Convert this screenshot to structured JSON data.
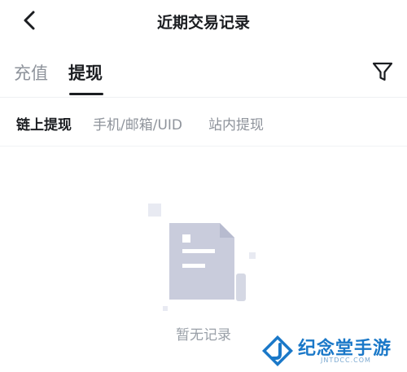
{
  "header": {
    "title": "近期交易记录",
    "back_icon": "chevron-left-icon"
  },
  "tabs": [
    {
      "label": "充值",
      "active": false
    },
    {
      "label": "提现",
      "active": true
    }
  ],
  "filter_icon": "filter-icon",
  "subtabs": [
    {
      "label": "链上提现",
      "active": true
    },
    {
      "label": "手机/邮箱/UID",
      "active": false
    },
    {
      "label": "站内提现",
      "active": false
    }
  ],
  "empty_state": {
    "text": "暂无记录",
    "icon": "empty-document-icon"
  },
  "watermark": {
    "title": "纪念堂手游",
    "subtitle": "JNTDCC.COM",
    "icon": "j-logo-icon"
  },
  "colors": {
    "text_primary": "#1b1d21",
    "text_secondary": "#8e939b",
    "illustration": "#c9ccdc",
    "watermark_blue": "#1a78c8"
  }
}
